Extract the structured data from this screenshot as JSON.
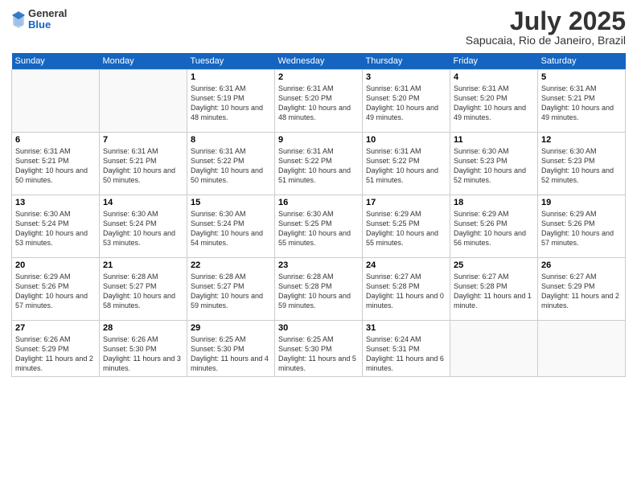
{
  "header": {
    "logo": {
      "general": "General",
      "blue": "Blue"
    },
    "month": "July 2025",
    "location": "Sapucaia, Rio de Janeiro, Brazil"
  },
  "weekdays": [
    "Sunday",
    "Monday",
    "Tuesday",
    "Wednesday",
    "Thursday",
    "Friday",
    "Saturday"
  ],
  "weeks": [
    [
      {
        "day": "",
        "detail": ""
      },
      {
        "day": "",
        "detail": ""
      },
      {
        "day": "1",
        "detail": "Sunrise: 6:31 AM\nSunset: 5:19 PM\nDaylight: 10 hours and 48 minutes."
      },
      {
        "day": "2",
        "detail": "Sunrise: 6:31 AM\nSunset: 5:20 PM\nDaylight: 10 hours and 48 minutes."
      },
      {
        "day": "3",
        "detail": "Sunrise: 6:31 AM\nSunset: 5:20 PM\nDaylight: 10 hours and 49 minutes."
      },
      {
        "day": "4",
        "detail": "Sunrise: 6:31 AM\nSunset: 5:20 PM\nDaylight: 10 hours and 49 minutes."
      },
      {
        "day": "5",
        "detail": "Sunrise: 6:31 AM\nSunset: 5:21 PM\nDaylight: 10 hours and 49 minutes."
      }
    ],
    [
      {
        "day": "6",
        "detail": "Sunrise: 6:31 AM\nSunset: 5:21 PM\nDaylight: 10 hours and 50 minutes."
      },
      {
        "day": "7",
        "detail": "Sunrise: 6:31 AM\nSunset: 5:21 PM\nDaylight: 10 hours and 50 minutes."
      },
      {
        "day": "8",
        "detail": "Sunrise: 6:31 AM\nSunset: 5:22 PM\nDaylight: 10 hours and 50 minutes."
      },
      {
        "day": "9",
        "detail": "Sunrise: 6:31 AM\nSunset: 5:22 PM\nDaylight: 10 hours and 51 minutes."
      },
      {
        "day": "10",
        "detail": "Sunrise: 6:31 AM\nSunset: 5:22 PM\nDaylight: 10 hours and 51 minutes."
      },
      {
        "day": "11",
        "detail": "Sunrise: 6:30 AM\nSunset: 5:23 PM\nDaylight: 10 hours and 52 minutes."
      },
      {
        "day": "12",
        "detail": "Sunrise: 6:30 AM\nSunset: 5:23 PM\nDaylight: 10 hours and 52 minutes."
      }
    ],
    [
      {
        "day": "13",
        "detail": "Sunrise: 6:30 AM\nSunset: 5:24 PM\nDaylight: 10 hours and 53 minutes."
      },
      {
        "day": "14",
        "detail": "Sunrise: 6:30 AM\nSunset: 5:24 PM\nDaylight: 10 hours and 53 minutes."
      },
      {
        "day": "15",
        "detail": "Sunrise: 6:30 AM\nSunset: 5:24 PM\nDaylight: 10 hours and 54 minutes."
      },
      {
        "day": "16",
        "detail": "Sunrise: 6:30 AM\nSunset: 5:25 PM\nDaylight: 10 hours and 55 minutes."
      },
      {
        "day": "17",
        "detail": "Sunrise: 6:29 AM\nSunset: 5:25 PM\nDaylight: 10 hours and 55 minutes."
      },
      {
        "day": "18",
        "detail": "Sunrise: 6:29 AM\nSunset: 5:26 PM\nDaylight: 10 hours and 56 minutes."
      },
      {
        "day": "19",
        "detail": "Sunrise: 6:29 AM\nSunset: 5:26 PM\nDaylight: 10 hours and 57 minutes."
      }
    ],
    [
      {
        "day": "20",
        "detail": "Sunrise: 6:29 AM\nSunset: 5:26 PM\nDaylight: 10 hours and 57 minutes."
      },
      {
        "day": "21",
        "detail": "Sunrise: 6:28 AM\nSunset: 5:27 PM\nDaylight: 10 hours and 58 minutes."
      },
      {
        "day": "22",
        "detail": "Sunrise: 6:28 AM\nSunset: 5:27 PM\nDaylight: 10 hours and 59 minutes."
      },
      {
        "day": "23",
        "detail": "Sunrise: 6:28 AM\nSunset: 5:28 PM\nDaylight: 10 hours and 59 minutes."
      },
      {
        "day": "24",
        "detail": "Sunrise: 6:27 AM\nSunset: 5:28 PM\nDaylight: 11 hours and 0 minutes."
      },
      {
        "day": "25",
        "detail": "Sunrise: 6:27 AM\nSunset: 5:28 PM\nDaylight: 11 hours and 1 minute."
      },
      {
        "day": "26",
        "detail": "Sunrise: 6:27 AM\nSunset: 5:29 PM\nDaylight: 11 hours and 2 minutes."
      }
    ],
    [
      {
        "day": "27",
        "detail": "Sunrise: 6:26 AM\nSunset: 5:29 PM\nDaylight: 11 hours and 2 minutes."
      },
      {
        "day": "28",
        "detail": "Sunrise: 6:26 AM\nSunset: 5:30 PM\nDaylight: 11 hours and 3 minutes."
      },
      {
        "day": "29",
        "detail": "Sunrise: 6:25 AM\nSunset: 5:30 PM\nDaylight: 11 hours and 4 minutes."
      },
      {
        "day": "30",
        "detail": "Sunrise: 6:25 AM\nSunset: 5:30 PM\nDaylight: 11 hours and 5 minutes."
      },
      {
        "day": "31",
        "detail": "Sunrise: 6:24 AM\nSunset: 5:31 PM\nDaylight: 11 hours and 6 minutes."
      },
      {
        "day": "",
        "detail": ""
      },
      {
        "day": "",
        "detail": ""
      }
    ]
  ]
}
